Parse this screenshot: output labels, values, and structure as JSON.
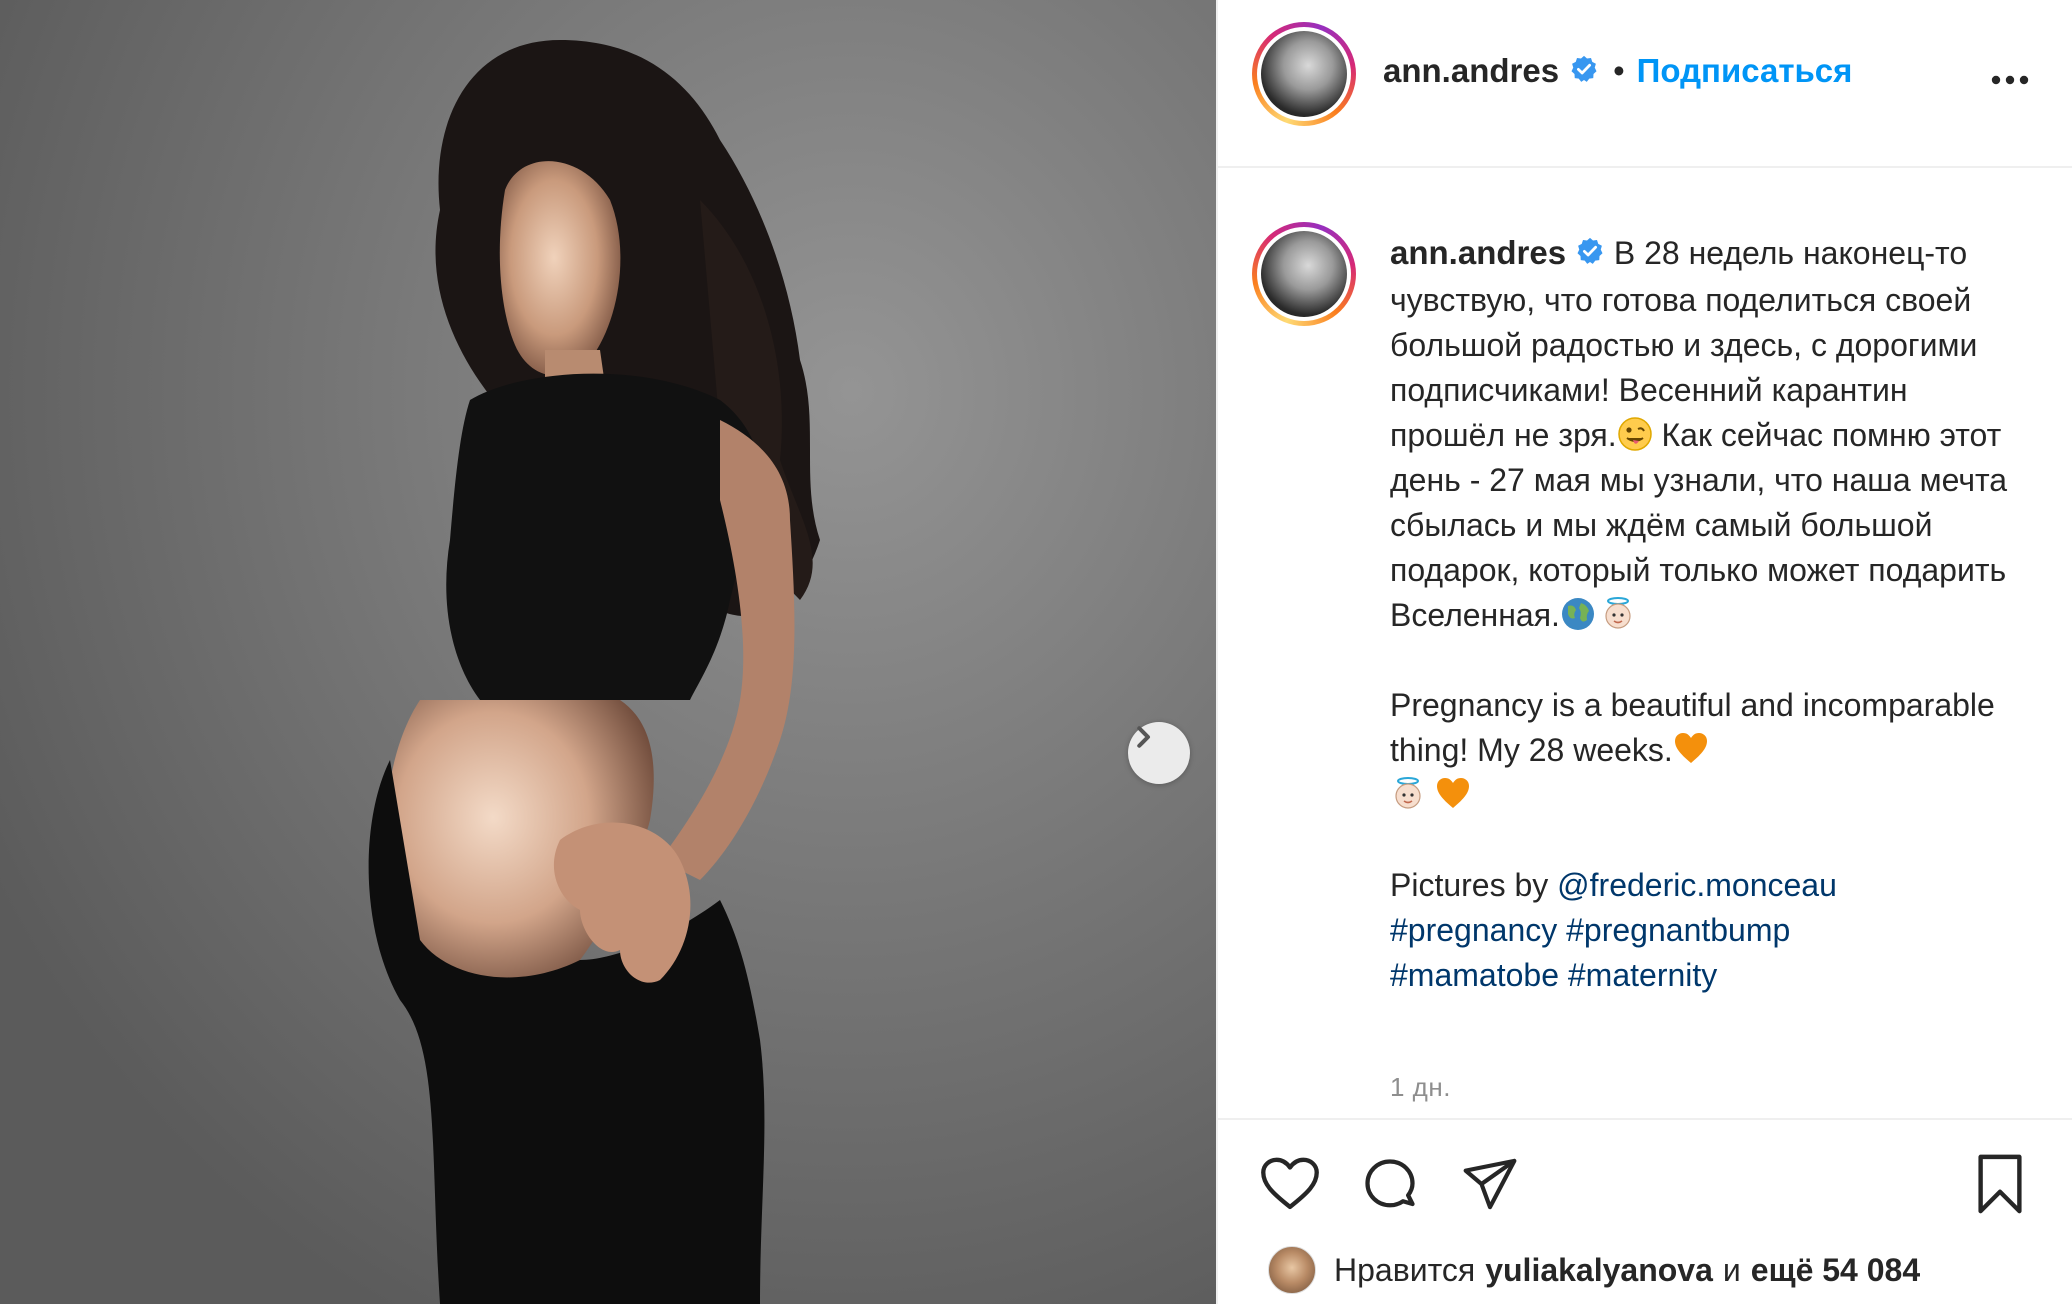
{
  "post": {
    "username": "ann.andres",
    "follow_separator": "•",
    "follow_label": "Подписаться",
    "verified_icon": "verified-badge-icon",
    "more_icon": "more-options-icon"
  },
  "caption": {
    "username": "ann.andres",
    "para1_line1": "В 28 недель наконец-то чувствую, что готова поделиться своей большой радостью и здесь, с дорогими подписчиками! Весенний карантин прошёл не зря.",
    "para1_line2": " Как сейчас помню этот день - 27 мая мы узнали, что наша мечта сбылась и мы ждём самый большой подарок, который только может подарить Вселенная.",
    "para2": "Pregnancy is a beautiful and incomparable thing! My 28 weeks.",
    "para3_prefix": "Pictures by ",
    "mention": "@frederic.monceau",
    "hashtags": [
      "#pregnancy",
      "#pregnantbump",
      "#mamatobe",
      "#maternity"
    ],
    "emojis": [
      "tongue-wink-emoji",
      "globe-emoji",
      "angel-emoji",
      "orange-heart-emoji",
      "angel-emoji",
      "orange-heart-emoji"
    ]
  },
  "timestamp": "1 дн.",
  "actions": {
    "icons": [
      "heart-icon",
      "comment-icon",
      "share-icon",
      "bookmark-icon"
    ]
  },
  "likes": {
    "prefix": "Нравится",
    "user": "yuliakalyanova",
    "middle": "и",
    "count_text": "ещё 54 084"
  },
  "colors": {
    "link": "#00376b",
    "follow": "#0095f6",
    "text": "#262626",
    "muted": "#8e8e8e",
    "verified": "#3897f0"
  }
}
